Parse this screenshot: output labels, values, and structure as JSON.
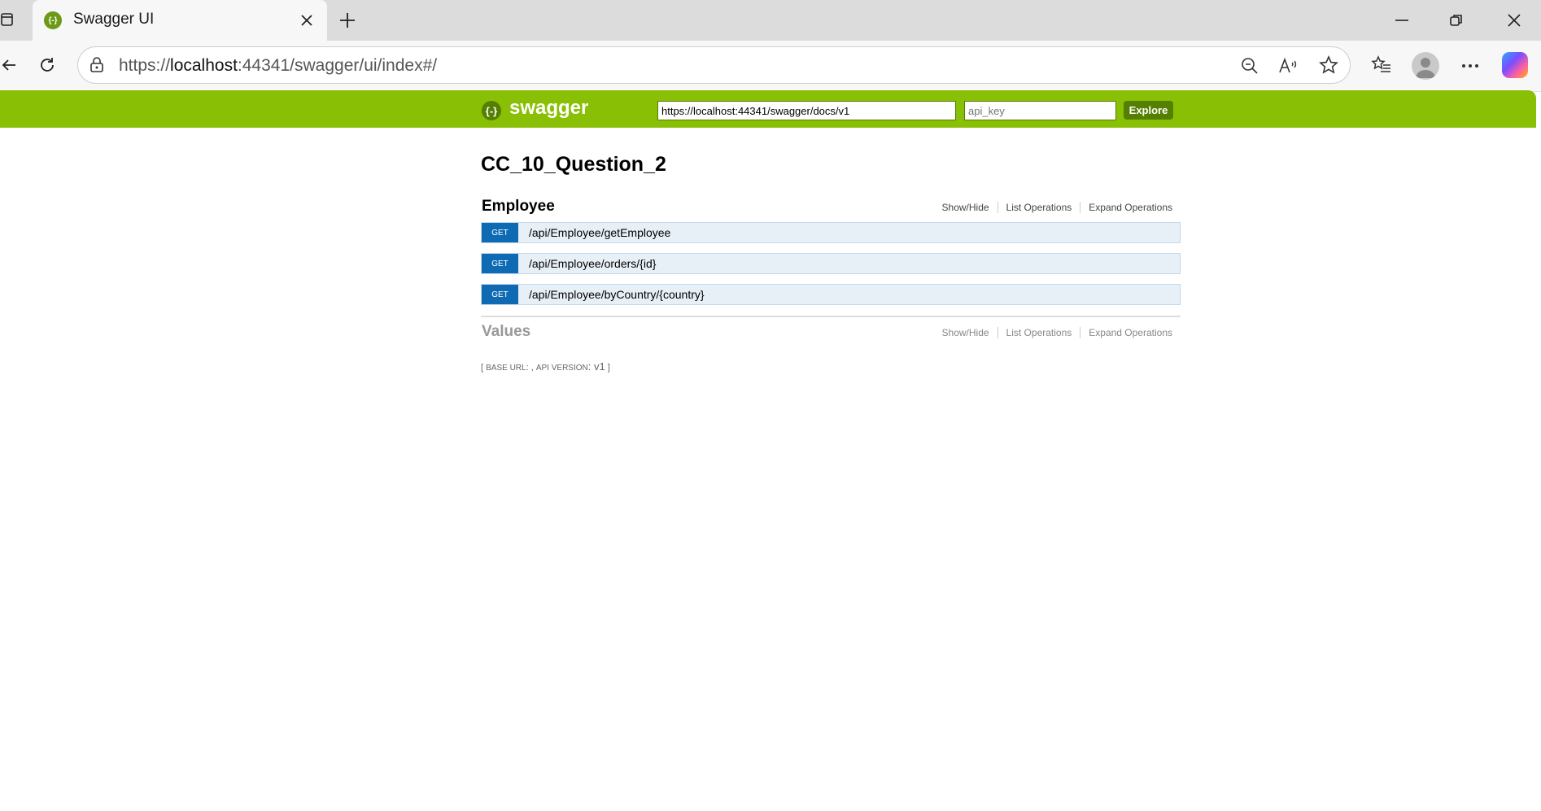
{
  "browser": {
    "tab_title": "Swagger UI",
    "url_prefix": "https://",
    "url_host": "localhost",
    "url_rest": ":44341/swagger/ui/index#/"
  },
  "swagger": {
    "logo_mark": "{-}",
    "logo_text": "swagger",
    "spec_url": "https://localhost:44341/swagger/docs/v1",
    "api_key_placeholder": "api_key",
    "explore_label": "Explore",
    "title": "CC_10_Question_2"
  },
  "resources": [
    {
      "name": "Employee",
      "show_hide": "Show/Hide",
      "list_ops": "List Operations",
      "expand_ops": "Expand Operations",
      "operations": [
        {
          "method": "GET",
          "path": "/api/Employee/getEmployee"
        },
        {
          "method": "GET",
          "path": "/api/Employee/orders/{id}"
        },
        {
          "method": "GET",
          "path": "/api/Employee/byCountry/{country}"
        }
      ]
    },
    {
      "name": "Values",
      "show_hide": "Show/Hide",
      "list_ops": "List Operations",
      "expand_ops": "Expand Operations"
    }
  ],
  "footer": {
    "open": "[ ",
    "base_url_label": "BASE URL",
    "mid": ": , ",
    "api_version_label": "API VERSION",
    "version_value": ": v1",
    "close": " ]"
  },
  "colors": {
    "header_green": "#89bf04",
    "explore_green": "#547f00",
    "get_blue": "#0f6ab4",
    "get_bg": "#e7f0f7"
  }
}
